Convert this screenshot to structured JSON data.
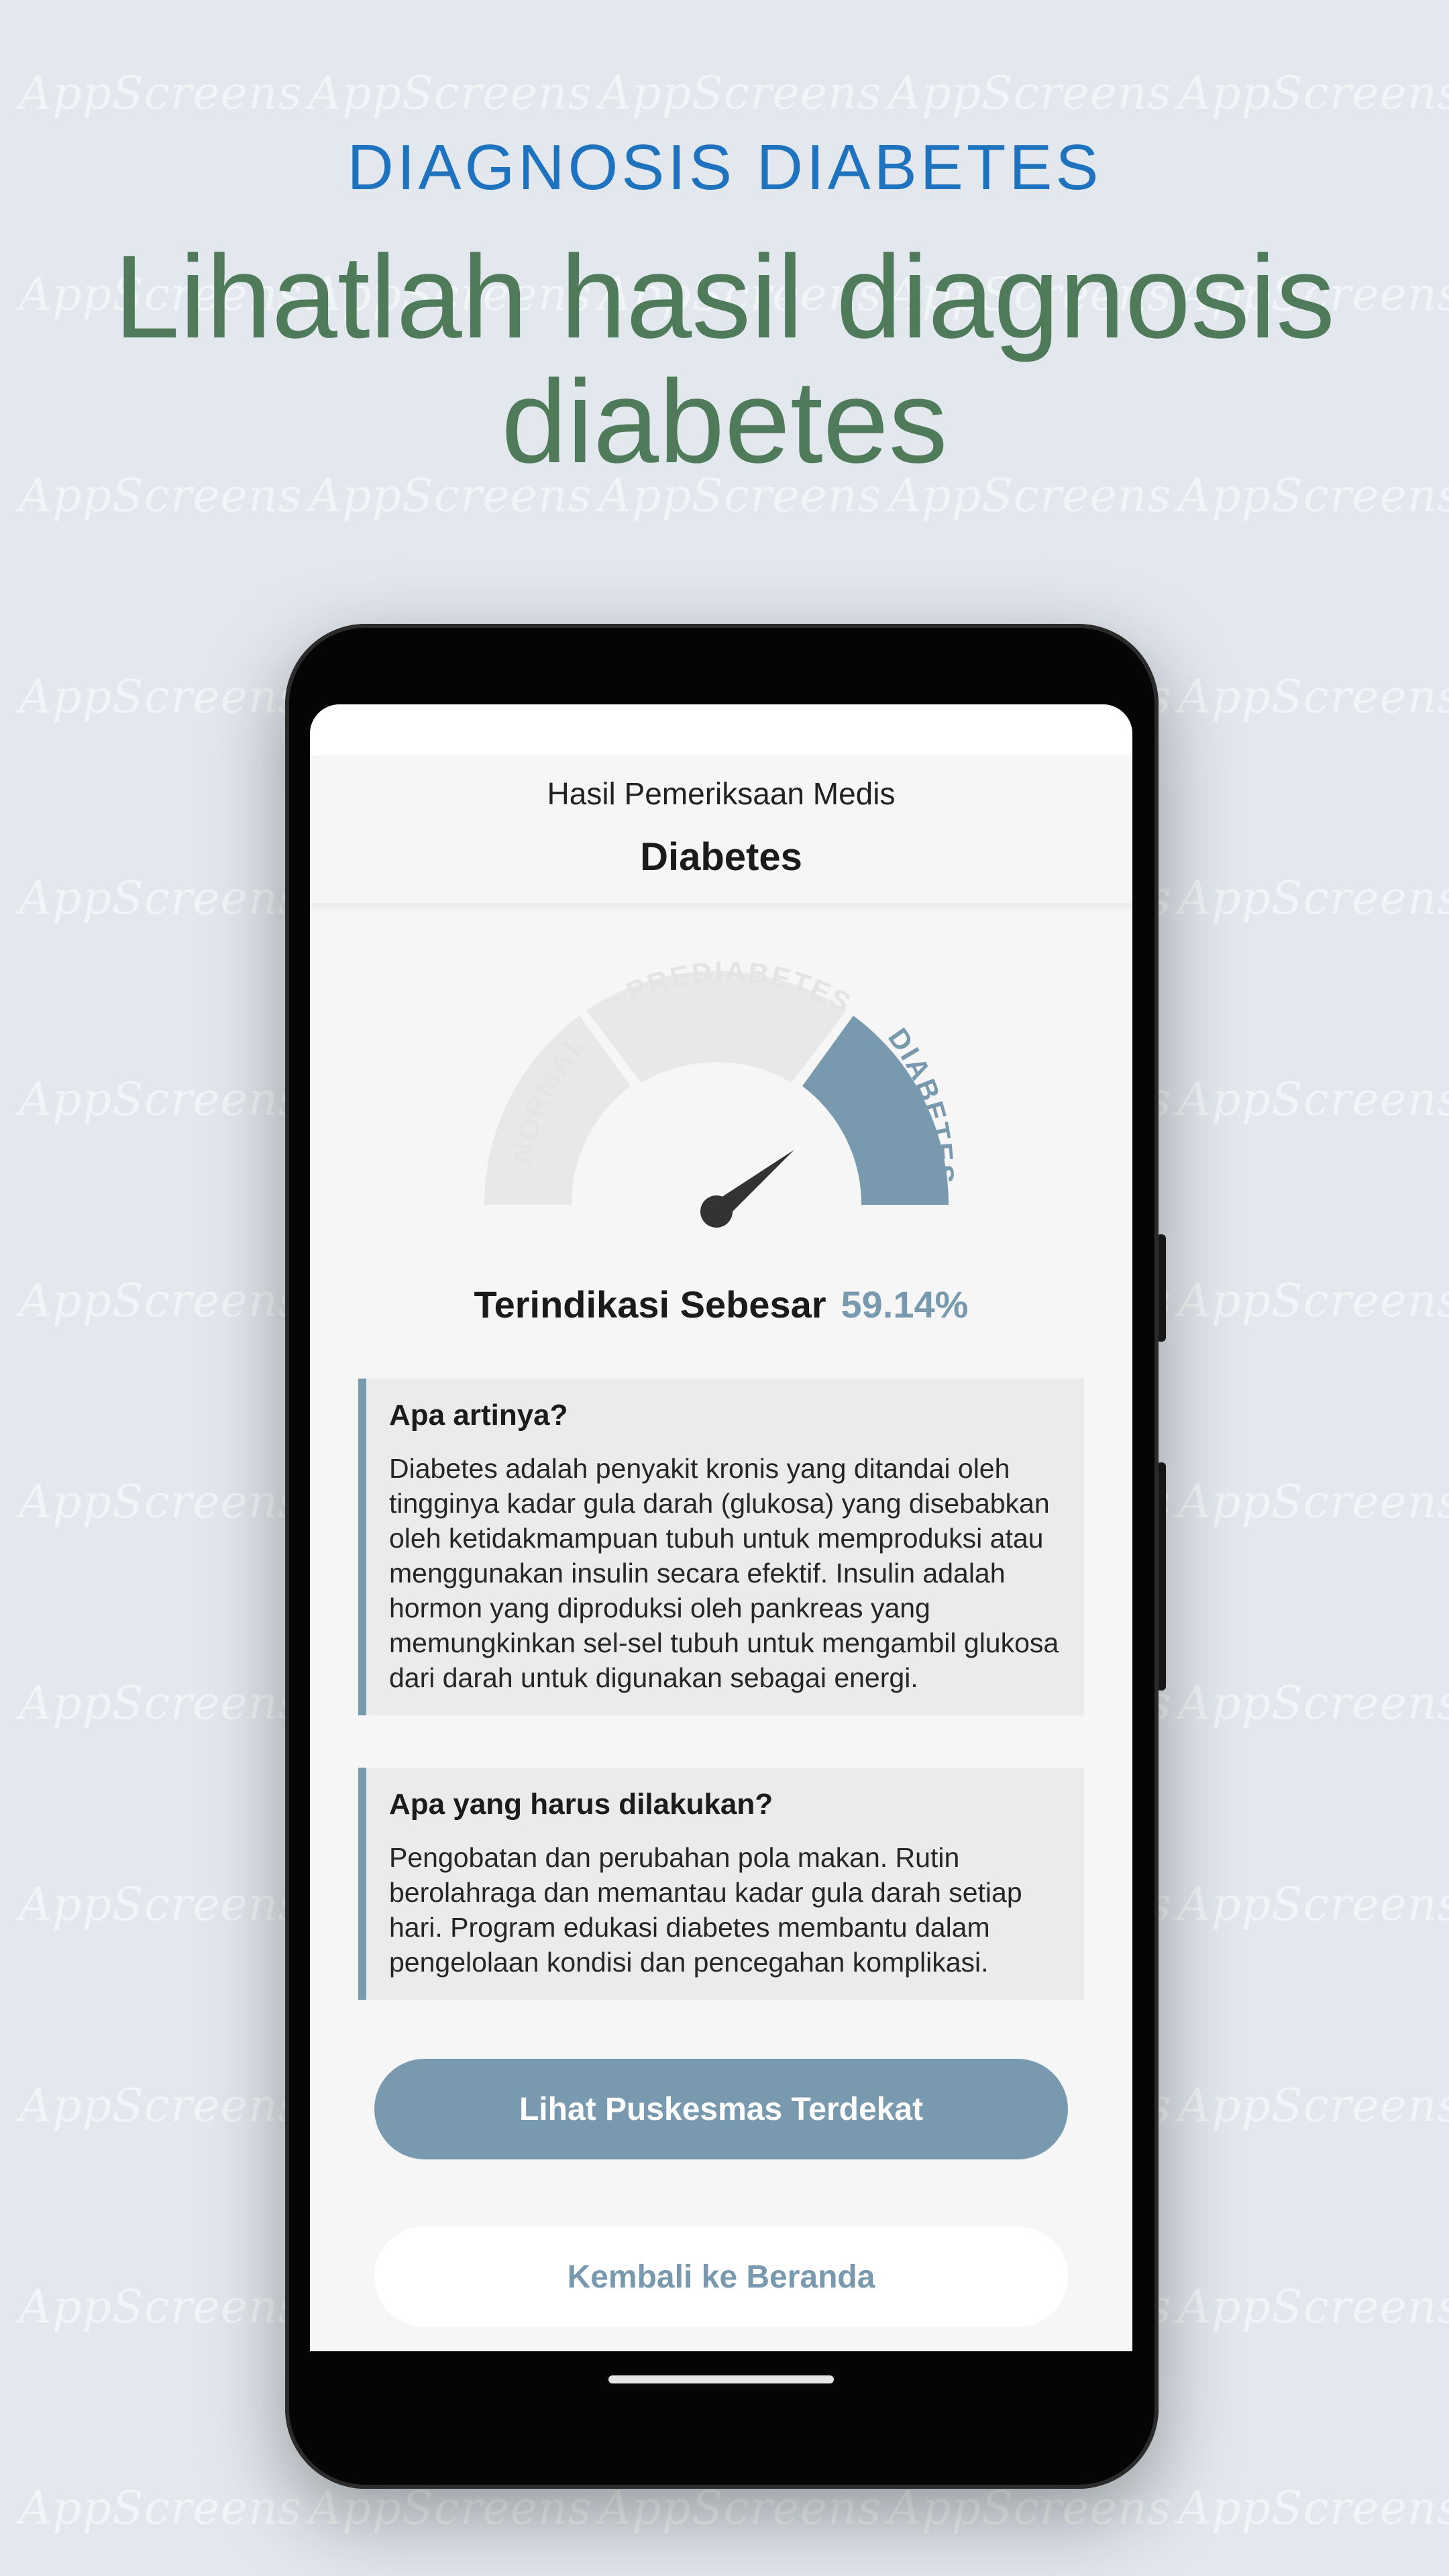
{
  "watermark": {
    "text": "AppScreens"
  },
  "promo": {
    "kicker": "DIAGNOSIS DIABETES",
    "title_line1": "Lihatlah hasil diagnosis",
    "title_line2": "diabetes"
  },
  "screen": {
    "header": {
      "subtitle": "Hasil Pemeriksaan Medis",
      "title": "Diabetes"
    },
    "gauge": {
      "segments": [
        "NORMAL",
        "PREDIABETES",
        "DIABETES"
      ],
      "active_segment": "DIABETES",
      "colors": {
        "active": "#7899ae",
        "inactive": "#e8e8e8",
        "needle": "#333333"
      }
    },
    "indicator": {
      "label": "Terindikasi Sebesar",
      "value": "59.14%"
    },
    "cards": [
      {
        "title": "Apa artinya?",
        "body": "Diabetes adalah penyakit kronis yang ditandai oleh tingginya kadar gula darah (glukosa) yang disebabkan oleh ketidakmampuan tubuh untuk memproduksi atau menggunakan insulin secara efektif. Insulin adalah hormon yang diproduksi oleh pankreas yang memungkinkan sel-sel tubuh untuk mengambil glukosa dari darah untuk digunakan sebagai energi."
      },
      {
        "title": "Apa yang harus dilakukan?",
        "body": "Pengobatan dan perubahan pola makan. Rutin berolahraga dan memantau kadar gula darah setiap hari. Program edukasi diabetes membantu dalam pengelolaan kondisi dan pencegahan komplikasi."
      }
    ],
    "buttons": {
      "primary": "Lihat Puskesmas Terdekat",
      "secondary": "Kembali ke Beranda"
    }
  },
  "colors": {
    "accent": "#7899ae",
    "kicker": "#1f73be",
    "headline": "#4f7b5a",
    "background": "#e2e8ee"
  }
}
